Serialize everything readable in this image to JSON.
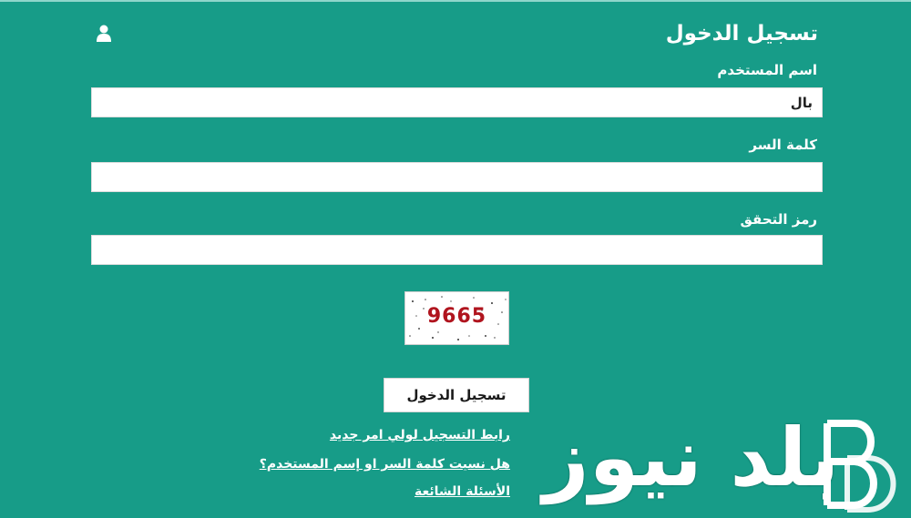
{
  "form": {
    "title": "تسجيل الدخول",
    "user_icon": "user-icon",
    "username_label": "اسم المستخدم",
    "username_value": "بال",
    "password_label": "كلمة السر",
    "password_value": "",
    "captcha_label": "رمز التحقق",
    "captcha_value": "",
    "captcha_code": "9665",
    "login_button": "تسجيل الدخول"
  },
  "links": {
    "parent_registration": "رابط التسجيل لولي امر جديد",
    "forgot_credentials": "هل نسيت كلمة السر او إسم المستخدم؟",
    "faq": "الأسئلة الشائعة"
  },
  "watermark": {
    "text": "بلد نيوز",
    "logo_letters": "BD"
  },
  "colors": {
    "background": "#179c88",
    "captcha_text": "#b0141e"
  }
}
